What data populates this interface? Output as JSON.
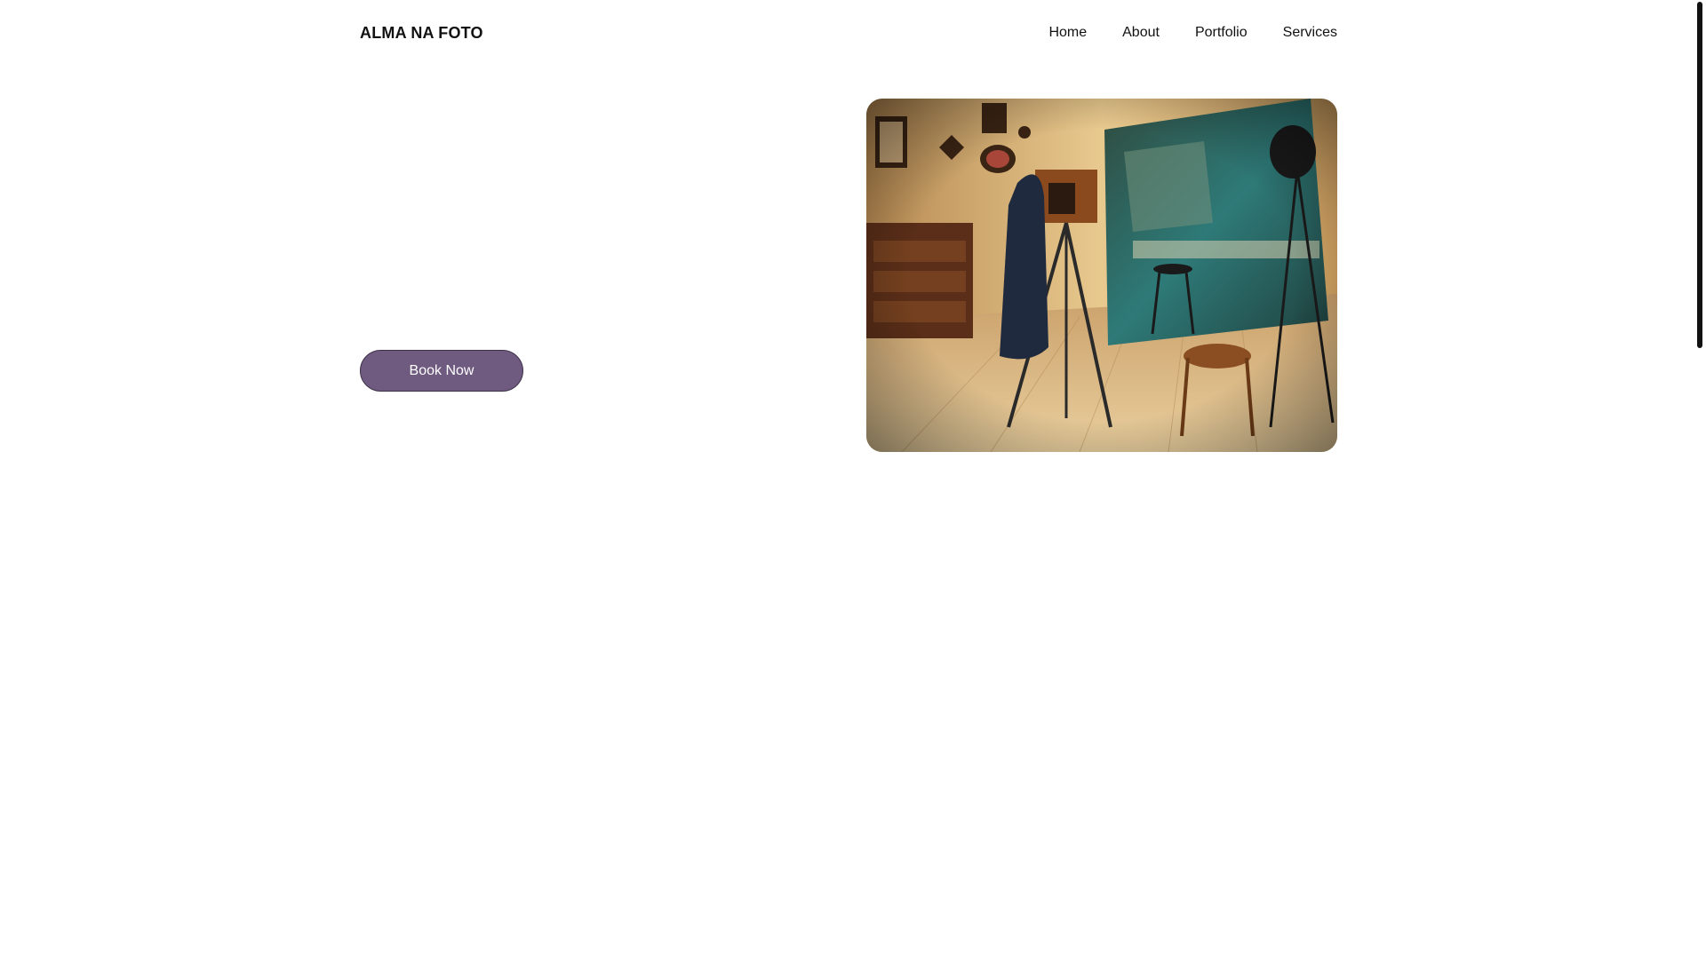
{
  "header": {
    "logo": "ALMA NA FOTO",
    "nav": [
      {
        "label": "Home"
      },
      {
        "label": "About"
      },
      {
        "label": "Portfolio"
      },
      {
        "label": "Services"
      }
    ]
  },
  "hero": {
    "cta_label": "Book Now",
    "image_icon": "photo-studio-image"
  },
  "colors": {
    "button_bg": "#6f5a80",
    "button_border": "#3e3148",
    "text": "#111111"
  }
}
